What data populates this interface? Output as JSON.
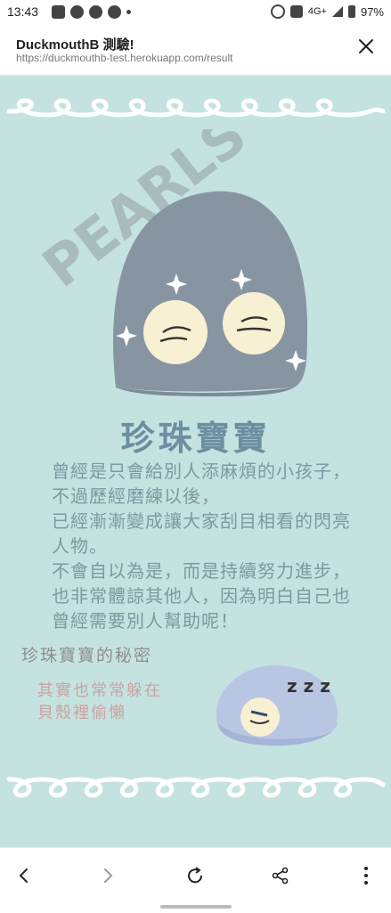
{
  "status_bar": {
    "time": "13:43",
    "notification_icons": [
      "message-icon",
      "line-icon",
      "facebook-icon",
      "facebook-icon"
    ],
    "network": "4G+",
    "battery": "97%"
  },
  "header": {
    "title": "DuckmouthB 測驗!",
    "url": "https://duckmouthb-test.herokuapp.com/result",
    "close_icon": "close-icon"
  },
  "result": {
    "art_word": "PEARLS",
    "title": "珍珠寶寶",
    "description": "曾經是只會給別人添麻煩的小孩子，不過歷經磨練以後，\n已經漸漸變成讓大家刮目相看的閃亮人物。\n不會自以為是，而是持續努力進步，也非常體諒其他人，因為明白自己也曾經需要別人幫助呢！",
    "secret_label": "珍珠寶寶的秘密",
    "secret_text": "其實也常常躲在\n貝殼裡偷懶",
    "sleep_text": "z z z"
  },
  "bottom_nav": {
    "icons": [
      "back-icon",
      "forward-icon",
      "reload-icon",
      "share-icon",
      "more-icon"
    ]
  },
  "colors": {
    "background": "#c4e2e0",
    "shell": "#8795a3",
    "pearl": "#f7f0d2",
    "title": "#6c8ea0",
    "text": "#7a9aa0",
    "secret_label": "#8f8f8a",
    "secret_text": "#c9a4a0"
  }
}
